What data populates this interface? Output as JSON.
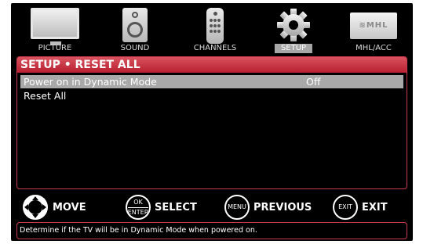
{
  "tabs": [
    {
      "label": "PICTURE",
      "icon": "tv-icon"
    },
    {
      "label": "SOUND",
      "icon": "speaker-icon"
    },
    {
      "label": "CHANNELS",
      "icon": "remote-icon"
    },
    {
      "label": "SETUP",
      "icon": "gear-icon",
      "active": true
    },
    {
      "label": "MHL/ACC",
      "icon": "mhl-icon",
      "logo_text": "≋MHL"
    }
  ],
  "panel": {
    "title": "SETUP • RESET ALL",
    "items": [
      {
        "label": "Power on in Dynamic Mode",
        "value": "Off",
        "selected": true
      },
      {
        "label": "Reset All",
        "value": ""
      }
    ]
  },
  "hints": [
    {
      "key": "",
      "label": "MOVE",
      "icon": "dpad-icon"
    },
    {
      "key": "OK ENTER",
      "key_top": "OK",
      "key_bottom": "ENTER",
      "label": "SELECT"
    },
    {
      "key": "MENU",
      "label": "PREVIOUS"
    },
    {
      "key": "EXIT",
      "label": "EXIT"
    }
  ],
  "help_text": "Determine if the TV will be in Dynamic Mode when powered on.",
  "colors": {
    "accent": "#c8374a",
    "title_bar": "#c72a3a",
    "selected_row": "#a9a9a9",
    "background": "#000000"
  }
}
